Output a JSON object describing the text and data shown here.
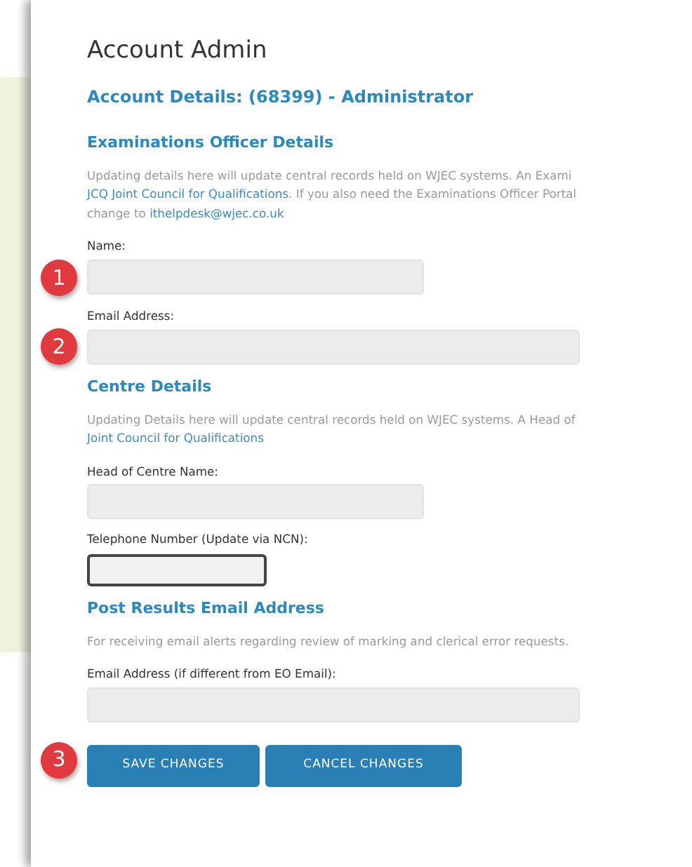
{
  "title": "Account Admin",
  "subtitle": "Account Details: (68399) - Administrator",
  "sections": [
    {
      "heading": "Examinations Officer Details",
      "paragraph": [
        [
          {
            "text": "Updating details here will update central records held on WJEC systems. An Exami"
          }
        ],
        [
          {
            "text": "JCQ Joint Council for Qualifications",
            "link": true
          },
          {
            "text": ". If you also need the Examinations Officer Portal"
          }
        ],
        [
          {
            "text": "change to "
          },
          {
            "text": "ithelpdesk@wjec.co.uk",
            "link": true
          }
        ]
      ],
      "fields": [
        {
          "label": "Name:",
          "kind": "text",
          "marker": "1"
        },
        {
          "label": "Email Address:",
          "kind": "email",
          "marker": "2"
        }
      ]
    },
    {
      "heading": "Centre Details",
      "paragraph": [
        [
          {
            "text": "Updating Details here will update central records held on WJEC systems. A Head of"
          }
        ],
        [
          {
            "text": "Joint Council for Qualifications",
            "link": true
          }
        ]
      ],
      "fields": [
        {
          "label": "Head of Centre Name:",
          "kind": "text"
        },
        {
          "label": "Telephone Number (Update via NCN):",
          "kind": "phone"
        }
      ]
    },
    {
      "heading": "Post Results Email Address",
      "paragraph": [
        [
          {
            "text": "For receiving email alerts regarding review of marking and clerical error requests."
          }
        ]
      ],
      "fields": [
        {
          "label": "Email Address (if different from EO Email):",
          "kind": "email"
        }
      ]
    }
  ],
  "buttons": [
    {
      "label": "SAVE CHANGES",
      "kind": "save",
      "marker": "3"
    },
    {
      "label": "CANCEL CHANGES",
      "kind": "cancel"
    }
  ]
}
